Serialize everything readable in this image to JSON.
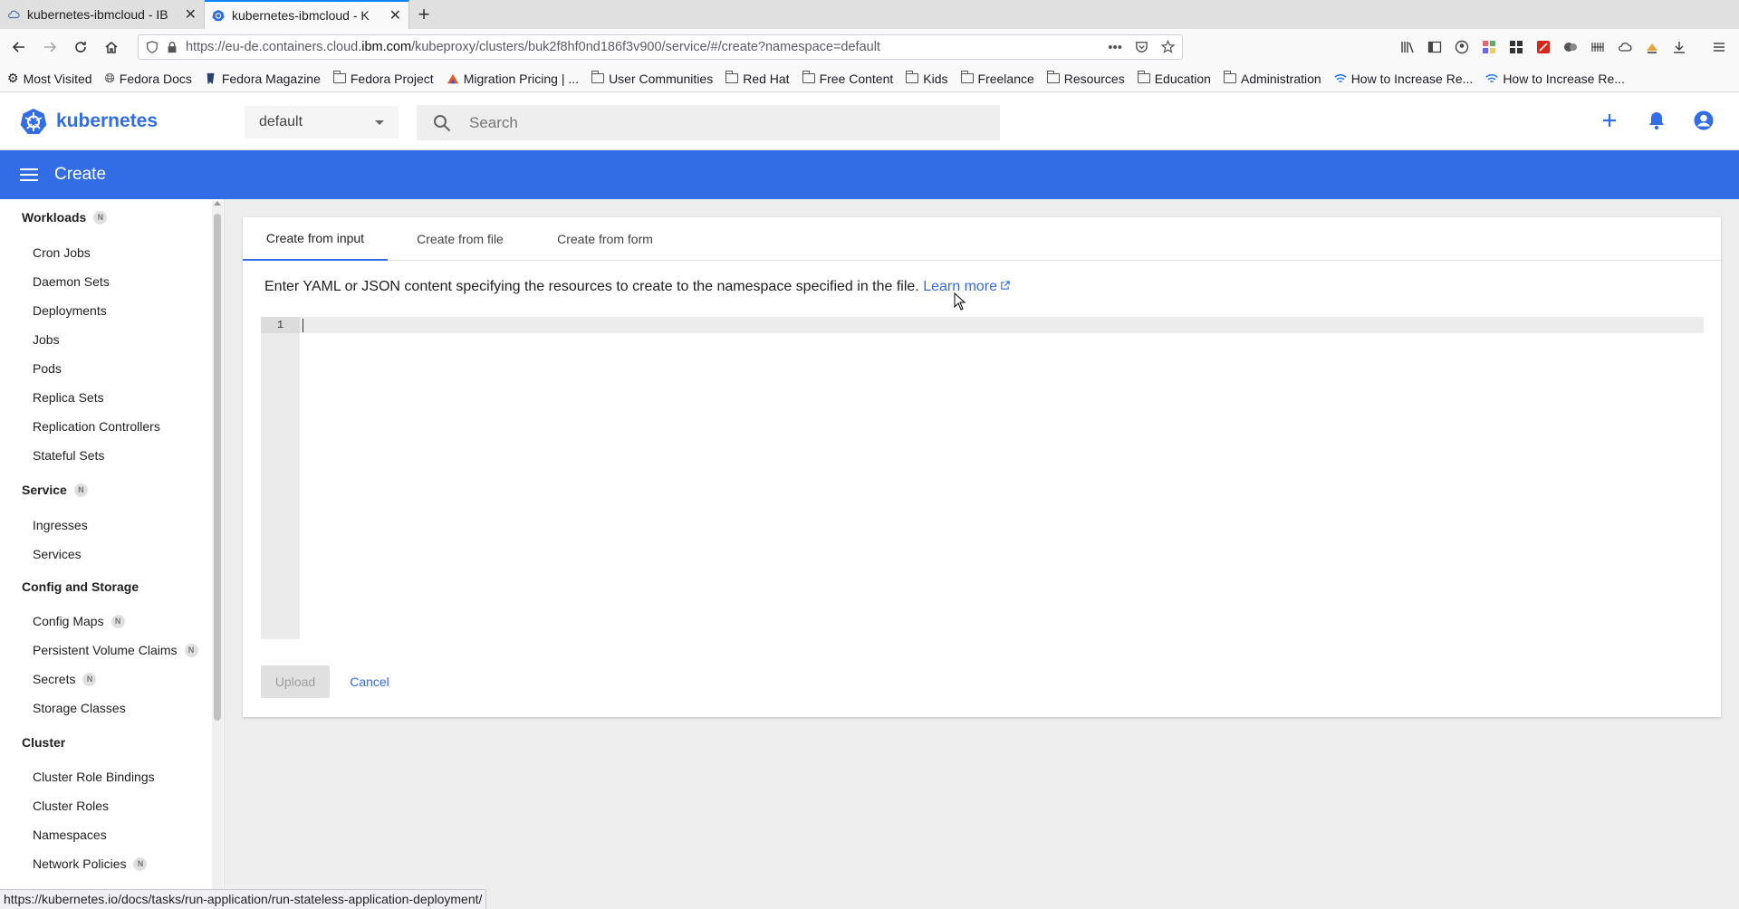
{
  "browser": {
    "tabs": [
      {
        "label": "kubernetes-ibmcloud - IB",
        "icon": "cloud-icon",
        "active": false
      },
      {
        "label": "kubernetes-ibmcloud - K",
        "icon": "kubernetes-icon",
        "active": true
      }
    ],
    "url_prefix": "https://eu-de.containers.cloud.",
    "url_domain": "ibm.com",
    "url_suffix": "/kubeproxy/clusters/buk2f8hf0nd186f3v900/service/#/create?namespace=default",
    "bookmarks": [
      {
        "label": "Most Visited",
        "icon": "gear-icon"
      },
      {
        "label": "Fedora Docs",
        "icon": "globe-icon"
      },
      {
        "label": "Fedora Magazine",
        "icon": "magazine-icon"
      },
      {
        "label": "Fedora Project",
        "icon": "folder-icon"
      },
      {
        "label": "Migration Pricing | ...",
        "icon": "migration-icon"
      },
      {
        "label": "User Communities",
        "icon": "folder-icon"
      },
      {
        "label": "Red Hat",
        "icon": "folder-icon"
      },
      {
        "label": "Free Content",
        "icon": "folder-icon"
      },
      {
        "label": "Kids",
        "icon": "folder-icon"
      },
      {
        "label": "Freelance",
        "icon": "folder-icon"
      },
      {
        "label": "Resources",
        "icon": "folder-icon"
      },
      {
        "label": "Education",
        "icon": "folder-icon"
      },
      {
        "label": "Administration",
        "icon": "folder-icon"
      },
      {
        "label": "How to Increase Re...",
        "icon": "wifi-icon"
      },
      {
        "label": "How to Increase Re...",
        "icon": "wifi-icon"
      }
    ],
    "status_url": "https://kubernetes.io/docs/tasks/run-application/run-stateless-application-deployment/"
  },
  "app": {
    "brand": "kubernetes",
    "namespace": "default",
    "search_placeholder": "Search",
    "page_title": "Create",
    "accent": "#326de6"
  },
  "sidebar": {
    "sections": [
      {
        "label": "Workloads",
        "badge": "N",
        "items": [
          {
            "label": "Cron Jobs"
          },
          {
            "label": "Daemon Sets"
          },
          {
            "label": "Deployments"
          },
          {
            "label": "Jobs"
          },
          {
            "label": "Pods"
          },
          {
            "label": "Replica Sets"
          },
          {
            "label": "Replication Controllers"
          },
          {
            "label": "Stateful Sets"
          }
        ]
      },
      {
        "label": "Service",
        "badge": "N",
        "items": [
          {
            "label": "Ingresses"
          },
          {
            "label": "Services"
          }
        ]
      },
      {
        "label": "Config and Storage",
        "badge": "",
        "items": [
          {
            "label": "Config Maps",
            "badge": "N"
          },
          {
            "label": "Persistent Volume Claims",
            "badge": "N"
          },
          {
            "label": "Secrets",
            "badge": "N"
          },
          {
            "label": "Storage Classes"
          }
        ]
      },
      {
        "label": "Cluster",
        "badge": "",
        "items": [
          {
            "label": "Cluster Role Bindings"
          },
          {
            "label": "Cluster Roles"
          },
          {
            "label": "Namespaces"
          },
          {
            "label": "Network Policies",
            "badge": "N"
          }
        ]
      }
    ]
  },
  "create": {
    "tabs": [
      "Create from input",
      "Create from file",
      "Create from form"
    ],
    "active_tab": 0,
    "description": "Enter YAML or JSON content specifying the resources to create to the namespace specified in the file.",
    "learn_more": "Learn more",
    "line_number": "1",
    "editor_value": "",
    "upload_label": "Upload",
    "cancel_label": "Cancel"
  }
}
